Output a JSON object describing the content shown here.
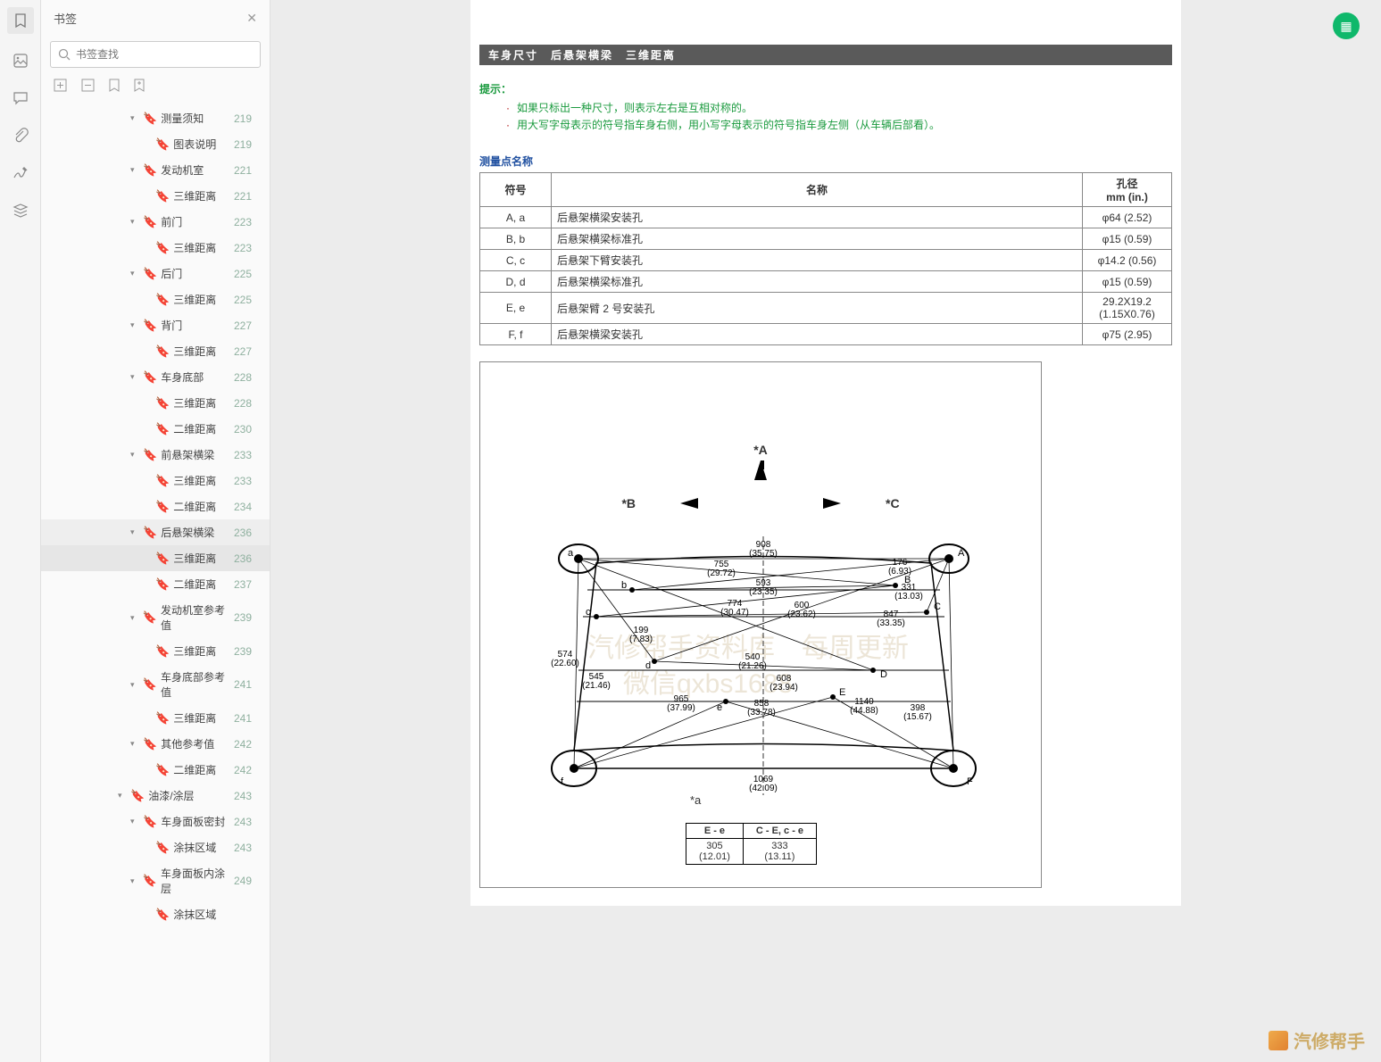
{
  "sidebar": {
    "title": "书签",
    "search_placeholder": "书签查找",
    "items": [
      {
        "lvl": 3,
        "toggle": "▾",
        "label": "测量须知",
        "page": "219"
      },
      {
        "lvl": 4,
        "toggle": "",
        "label": "图表说明",
        "page": "219"
      },
      {
        "lvl": 3,
        "toggle": "▾",
        "label": "发动机室",
        "page": "221"
      },
      {
        "lvl": 4,
        "toggle": "",
        "label": "三维距离",
        "page": "221"
      },
      {
        "lvl": 3,
        "toggle": "▾",
        "label": "前门",
        "page": "223"
      },
      {
        "lvl": 4,
        "toggle": "",
        "label": "三维距离",
        "page": "223"
      },
      {
        "lvl": 3,
        "toggle": "▾",
        "label": "后门",
        "page": "225"
      },
      {
        "lvl": 4,
        "toggle": "",
        "label": "三维距离",
        "page": "225"
      },
      {
        "lvl": 3,
        "toggle": "▾",
        "label": "背门",
        "page": "227"
      },
      {
        "lvl": 4,
        "toggle": "",
        "label": "三维距离",
        "page": "227"
      },
      {
        "lvl": 3,
        "toggle": "▾",
        "label": "车身底部",
        "page": "228"
      },
      {
        "lvl": 4,
        "toggle": "",
        "label": "三维距离",
        "page": "228"
      },
      {
        "lvl": 4,
        "toggle": "",
        "label": "二维距离",
        "page": "230"
      },
      {
        "lvl": 3,
        "toggle": "▾",
        "label": "前悬架横梁",
        "page": "233"
      },
      {
        "lvl": 4,
        "toggle": "",
        "label": "三维距离",
        "page": "233"
      },
      {
        "lvl": 4,
        "toggle": "",
        "label": "二维距离",
        "page": "234"
      },
      {
        "lvl": 3,
        "toggle": "▾",
        "label": "后悬架横梁",
        "page": "236",
        "highlight": true
      },
      {
        "lvl": 4,
        "toggle": "",
        "label": "三维距离",
        "page": "236",
        "active": true
      },
      {
        "lvl": 4,
        "toggle": "",
        "label": "二维距离",
        "page": "237"
      },
      {
        "lvl": 3,
        "toggle": "▾",
        "label": "发动机室参考值",
        "page": "239"
      },
      {
        "lvl": 4,
        "toggle": "",
        "label": "三维距离",
        "page": "239"
      },
      {
        "lvl": 3,
        "toggle": "▾",
        "label": "车身底部参考值",
        "page": "241"
      },
      {
        "lvl": 4,
        "toggle": "",
        "label": "三维距离",
        "page": "241"
      },
      {
        "lvl": 3,
        "toggle": "▾",
        "label": "其他参考值",
        "page": "242"
      },
      {
        "lvl": 4,
        "toggle": "",
        "label": "二维距离",
        "page": "242"
      },
      {
        "lvl": 2,
        "toggle": "▾",
        "label": "油漆/涂层",
        "page": "243"
      },
      {
        "lvl": 3,
        "toggle": "▾",
        "label": "车身面板密封",
        "page": "243"
      },
      {
        "lvl": 4,
        "toggle": "",
        "label": "涂抹区域",
        "page": "243"
      },
      {
        "lvl": 3,
        "toggle": "▾",
        "label": "车身面板内涂层",
        "page": "249"
      },
      {
        "lvl": 4,
        "toggle": "",
        "label": "涂抹区域",
        "page": ""
      }
    ]
  },
  "doc": {
    "title_bar": "车身尺寸　后悬架横梁　三维距离",
    "hint_label": "提示：",
    "hints": [
      "如果只标出一种尺寸，则表示左右是互相对称的。",
      "用大写字母表示的符号指车身右侧，用小写字母表示的符号指车身左侧（从车辆后部看）。"
    ],
    "section_label": "测量点名称",
    "table_headers": {
      "sym": "符号",
      "name": "名称",
      "dia": "孔径\nmm (in.)"
    },
    "rows": [
      {
        "sym": "A, a",
        "name": "后悬架横梁安装孔",
        "dia": "φ64 (2.52)"
      },
      {
        "sym": "B, b",
        "name": "后悬架横梁标准孔",
        "dia": "φ15 (0.59)"
      },
      {
        "sym": "C, c",
        "name": "后悬架下臂安装孔",
        "dia": "φ14.2 (0.56)"
      },
      {
        "sym": "D, d",
        "name": "后悬架横梁标准孔",
        "dia": "φ15 (0.59)"
      },
      {
        "sym": "E, e",
        "name": "后悬架臂 2 号安装孔",
        "dia": "29.2X19.2\n(1.15X0.76)"
      },
      {
        "sym": "F, f",
        "name": "后悬架横梁安装孔",
        "dia": "φ75 (2.95)"
      }
    ],
    "dir": {
      "a": "*A",
      "b": "*B",
      "c": "*C"
    },
    "tiny_label": "*a",
    "tiny_headers": [
      "E - e",
      "C - E, c - e"
    ],
    "tiny_row": [
      "305\n(12.01)",
      "333\n(13.11)"
    ],
    "dims": {
      "d908": "908\n(35.75)",
      "d755": "755\n(29.72)",
      "d176": "176\n(6.93)",
      "d593": "593\n(23.35)",
      "d331": "331\n(13.03)",
      "d774": "774\n(30.47)",
      "d600": "600\n(23.62)",
      "d847": "847\n(33.35)",
      "d199": "199\n(7.83)",
      "d540": "540\n(21.26)",
      "d574": "574\n(22.60)",
      "d545": "545\n(21.46)",
      "d608": "608\n(23.94)",
      "d965": "965\n(37.99)",
      "d858": "858\n(33.78)",
      "d1140": "1140\n(44.88)",
      "d398": "398\n(15.67)",
      "d1069": "1069\n(42.09)"
    },
    "watermark1": "汽修帮手资料库　每周更新",
    "watermark2": "微信qxbs1688",
    "brand": "汽修帮手"
  }
}
